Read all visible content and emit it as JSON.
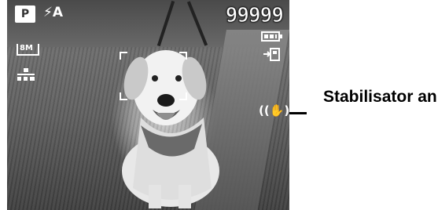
{
  "osd": {
    "mode": "P",
    "flash": "⚡A",
    "shots_remaining": "99999",
    "resolution": "8M",
    "stabilizer_glyph": "((✋))"
  },
  "icons": {
    "mode": "program-mode-icon",
    "flash": "flash-auto-icon",
    "battery": "battery-full-icon",
    "storage": "internal-memory-icon",
    "resolution": "image-size-icon",
    "quality": "quality-icon",
    "stabilizer": "stabilizer-icon"
  },
  "callout": {
    "label": "Stabilisator an"
  }
}
